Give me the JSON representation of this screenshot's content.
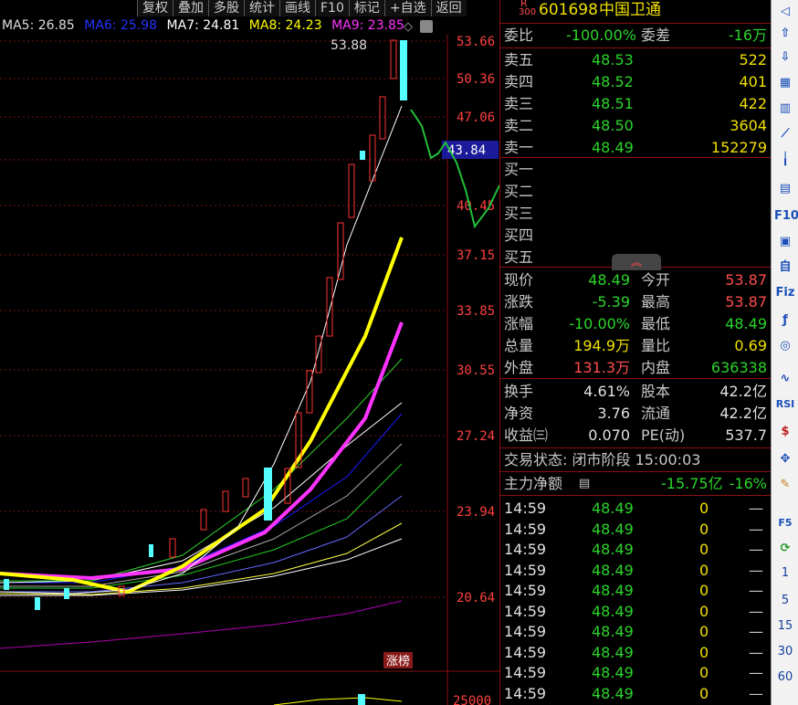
{
  "toolbar": {
    "items": [
      "复权",
      "叠加",
      "多股",
      "统计",
      "画线",
      "F10",
      "标记",
      "+自选",
      "返回"
    ]
  },
  "ma_legend": [
    {
      "label": "MA5: 26.85",
      "color": "#ffffff"
    },
    {
      "label": "MA6: 25.98",
      "color": "#2233ff"
    },
    {
      "label": "MA7: 24.81",
      "color": "#ffffff"
    },
    {
      "label": "MA8: 24.23",
      "color": "#ffff00"
    },
    {
      "label": "MA9: 23.85",
      "color": "#ff33ff"
    }
  ],
  "chart": {
    "peak_label": "53.88",
    "y_labels": [
      "53.66",
      "50.36",
      "47.06",
      "43.84",
      "40.45",
      "37.15",
      "33.85",
      "30.55",
      "27.24",
      "23.94",
      "20.64"
    ],
    "current_price_tag": "43.84",
    "badge": "涨榜",
    "volume_label": "25000"
  },
  "stock": {
    "code": "601698",
    "name": "中国卫通",
    "tag_top": "R",
    "tag_bottom": "300"
  },
  "weibi": {
    "label": "委比",
    "value": "-100.00%",
    "label2": "委差",
    "value2": "-16万"
  },
  "sell": [
    {
      "label": "卖五",
      "price": "48.53",
      "vol": "522"
    },
    {
      "label": "卖四",
      "price": "48.52",
      "vol": "401"
    },
    {
      "label": "卖三",
      "price": "48.51",
      "vol": "422"
    },
    {
      "label": "卖二",
      "price": "48.50",
      "vol": "3604"
    },
    {
      "label": "卖一",
      "price": "48.49",
      "vol": "152279"
    }
  ],
  "buy": [
    {
      "label": "买一"
    },
    {
      "label": "买二"
    },
    {
      "label": "买三"
    },
    {
      "label": "买四"
    },
    {
      "label": "买五"
    }
  ],
  "quote": [
    {
      "l1": "现价",
      "v1": "48.49",
      "l2": "今开",
      "v2": "53.87"
    },
    {
      "l1": "涨跌",
      "v1": "-5.39",
      "l2": "最高",
      "v2": "53.87"
    },
    {
      "l1": "涨幅",
      "v1": "-10.00%",
      "l2": "最低",
      "v2": "48.49"
    },
    {
      "l1": "总量",
      "v1": "194.9万",
      "l2": "量比",
      "v2": "0.69"
    },
    {
      "l1": "外盘",
      "v1": "131.3万",
      "l2": "内盘",
      "v2": "636338"
    }
  ],
  "stats": [
    {
      "l1": "换手",
      "v1": "4.61%",
      "l2": "股本",
      "v2": "42.2亿"
    },
    {
      "l1": "净资",
      "v1": "3.76",
      "l2": "流通",
      "v2": "42.2亿"
    },
    {
      "l1": "收益㈢",
      "v1": "0.070",
      "l2": "PE(动)",
      "v2": "537.7"
    }
  ],
  "trade_status": "交易状态: 闭市阶段 15:00:03",
  "main_force": {
    "label": "主力净额",
    "value": "-15.75亿",
    "pct": "-16%"
  },
  "ticks": [
    {
      "time": "14:59",
      "price": "48.49",
      "vol": "0",
      "dir": "—"
    },
    {
      "time": "14:59",
      "price": "48.49",
      "vol": "0",
      "dir": "—"
    },
    {
      "time": "14:59",
      "price": "48.49",
      "vol": "0",
      "dir": "—"
    },
    {
      "time": "14:59",
      "price": "48.49",
      "vol": "0",
      "dir": "—"
    },
    {
      "time": "14:59",
      "price": "48.49",
      "vol": "0",
      "dir": "—"
    },
    {
      "time": "14:59",
      "price": "48.49",
      "vol": "0",
      "dir": "—"
    },
    {
      "time": "14:59",
      "price": "48.49",
      "vol": "0",
      "dir": "—"
    },
    {
      "time": "14:59",
      "price": "48.49",
      "vol": "0",
      "dir": "—"
    },
    {
      "time": "14:59",
      "price": "48.49",
      "vol": "0",
      "dir": "—"
    },
    {
      "time": "14:59",
      "price": "48.49",
      "vol": "0",
      "dir": "—"
    }
  ],
  "side_numbers": [
    "1",
    "5",
    "15",
    "30",
    "60"
  ],
  "side_icons": [
    "RSI",
    "F10",
    "F5",
    "Fiz"
  ]
}
